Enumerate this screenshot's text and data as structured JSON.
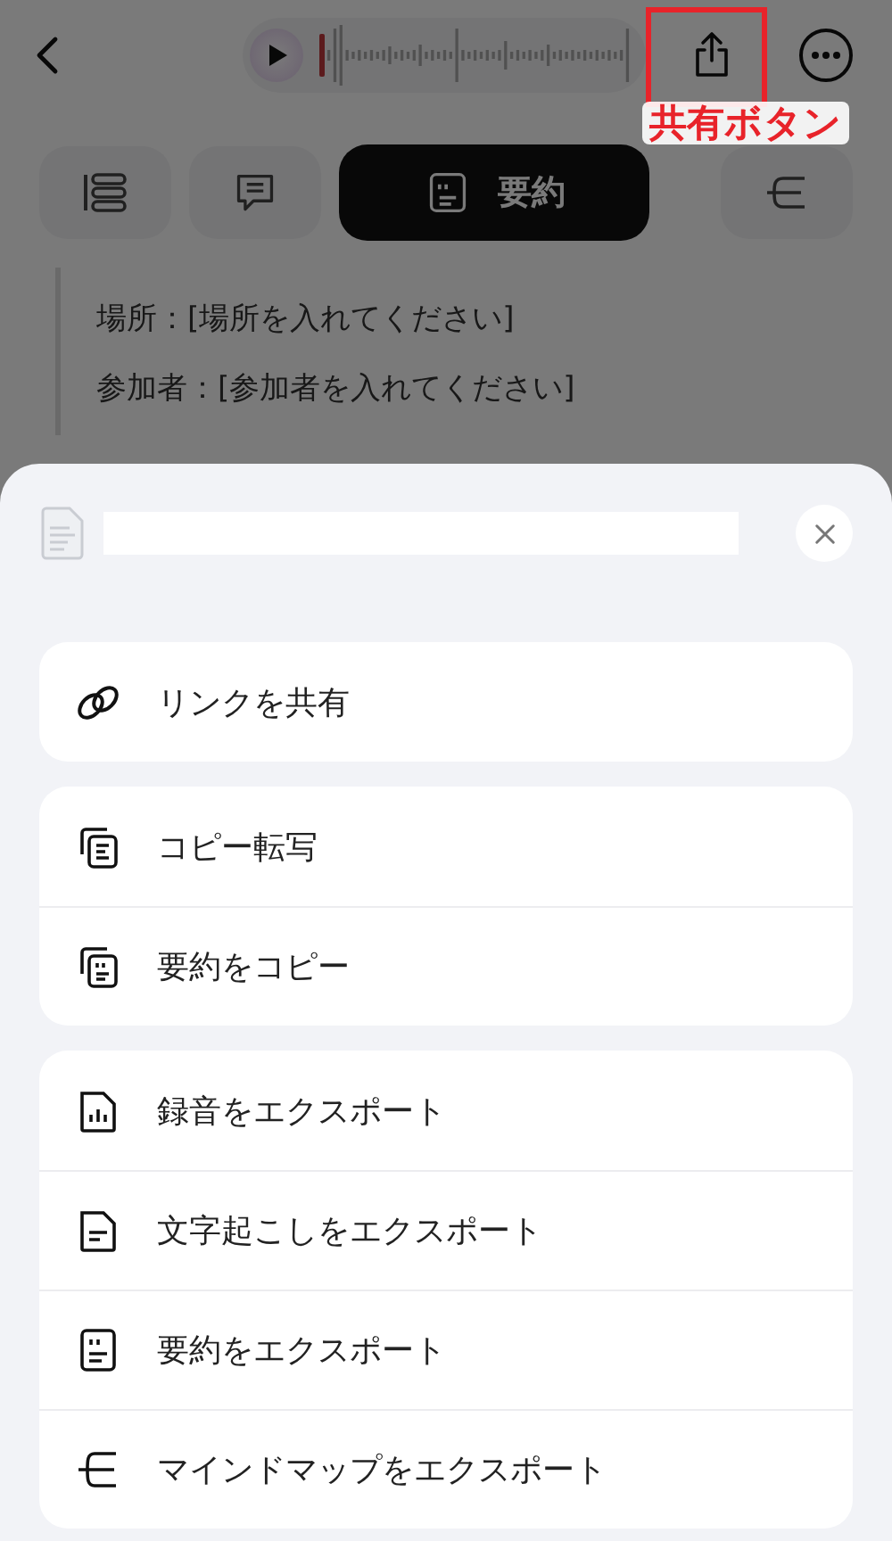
{
  "tabs": [
    {
      "kind": "list",
      "selected": false
    },
    {
      "kind": "comments",
      "selected": false
    },
    {
      "kind": "summary",
      "label": "要約",
      "selected": true
    },
    {
      "kind": "mindmap",
      "selected": false
    }
  ],
  "content_lines": [
    "場所：[場所を入れてください]",
    "参加者：[参加者を入れてください]"
  ],
  "share_sheet": {
    "groups": [
      {
        "items": [
          {
            "kind": "link",
            "label": "リンクを共有"
          }
        ]
      },
      {
        "items": [
          {
            "kind": "copy_transcript",
            "label": "コピー転写"
          },
          {
            "kind": "copy_summary",
            "label": "要約をコピー"
          }
        ]
      },
      {
        "items": [
          {
            "kind": "audio_file",
            "label": "録音をエクスポート"
          },
          {
            "kind": "text_file",
            "label": "文字起こしをエクスポート"
          },
          {
            "kind": "summary_file",
            "label": "要約をエクスポート"
          },
          {
            "kind": "mindmap",
            "label": "マインドマップをエクスポート"
          }
        ]
      }
    ]
  },
  "annotation": {
    "label": "共有ボタン"
  }
}
